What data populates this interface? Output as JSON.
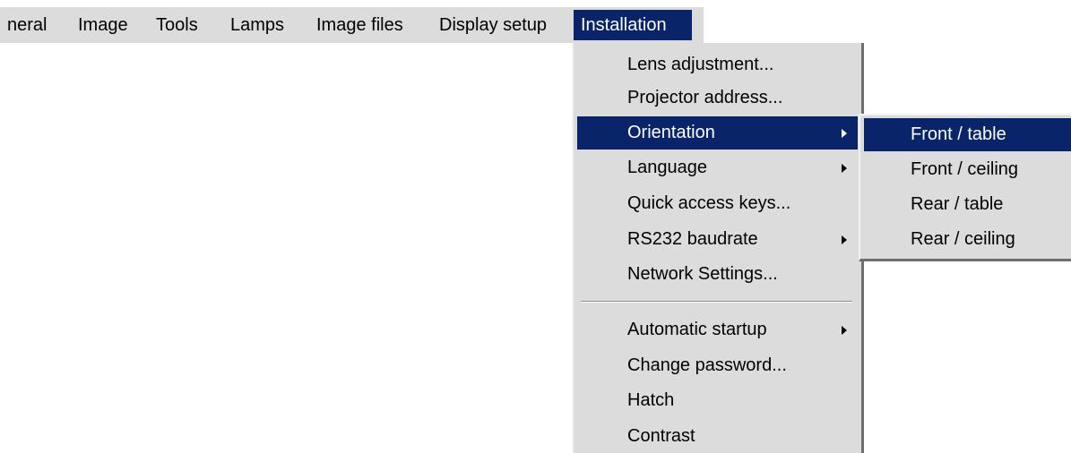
{
  "menubar": {
    "items": [
      {
        "label": "neral"
      },
      {
        "label": "Image"
      },
      {
        "label": "Tools"
      },
      {
        "label": "Lamps"
      },
      {
        "label": "Image files"
      },
      {
        "label": "Display setup"
      },
      {
        "label": "Installation",
        "active": true
      }
    ]
  },
  "installation_menu": {
    "items": [
      {
        "label": "Lens adjustment...",
        "submenu": false
      },
      {
        "label": "Projector address...",
        "submenu": false
      },
      {
        "label": "Orientation",
        "submenu": true,
        "active": true
      },
      {
        "label": "Language",
        "submenu": true
      },
      {
        "label": "Quick access keys...",
        "submenu": false
      },
      {
        "label": "RS232 baudrate",
        "submenu": true
      },
      {
        "label": "Network Settings...",
        "submenu": false
      },
      {
        "label": "Automatic startup",
        "submenu": true
      },
      {
        "label": "Change password...",
        "submenu": false
      },
      {
        "label": "Hatch",
        "submenu": false
      },
      {
        "label": "Contrast",
        "submenu": false
      }
    ]
  },
  "orientation_submenu": {
    "items": [
      {
        "label": "Front / table",
        "active": true
      },
      {
        "label": "Front / ceiling"
      },
      {
        "label": "Rear / table"
      },
      {
        "label": "Rear / ceiling"
      }
    ]
  },
  "colors": {
    "menu_background": "#dcdcdc",
    "highlight": "#0a246a",
    "highlight_text": "#ffffff"
  },
  "icons": {
    "submenu_arrow": "chevron-right-icon"
  }
}
